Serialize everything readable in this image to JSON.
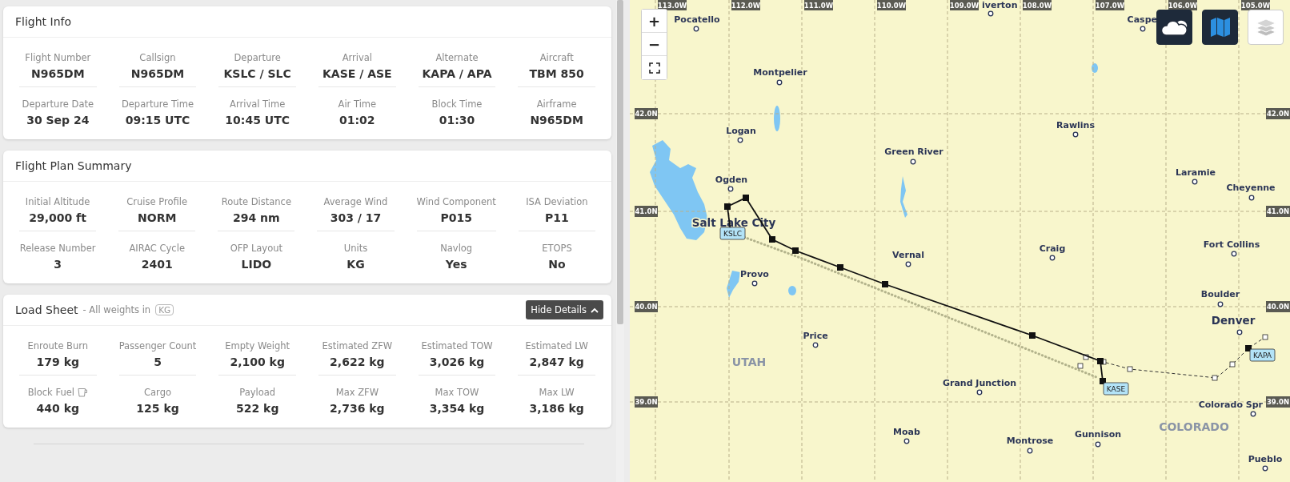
{
  "flight_info": {
    "title": "Flight Info",
    "fields": [
      {
        "label": "Flight Number",
        "value": "N965DM"
      },
      {
        "label": "Callsign",
        "value": "N965DM"
      },
      {
        "label": "Departure",
        "value": "KSLC / SLC"
      },
      {
        "label": "Arrival",
        "value": "KASE / ASE"
      },
      {
        "label": "Alternate",
        "value": "KAPA / APA"
      },
      {
        "label": "Aircraft",
        "value": "TBM 850"
      },
      {
        "label": "Departure Date",
        "value": "30 Sep 24"
      },
      {
        "label": "Departure Time",
        "value": "09:15 UTC"
      },
      {
        "label": "Arrival Time",
        "value": "10:45 UTC"
      },
      {
        "label": "Air Time",
        "value": "01:02"
      },
      {
        "label": "Block Time",
        "value": "01:30"
      },
      {
        "label": "Airframe",
        "value": "N965DM"
      }
    ]
  },
  "flight_plan_summary": {
    "title": "Flight Plan Summary",
    "fields": [
      {
        "label": "Initial Altitude",
        "value": "29,000 ft"
      },
      {
        "label": "Cruise Profile",
        "value": "NORM"
      },
      {
        "label": "Route Distance",
        "value": "294 nm"
      },
      {
        "label": "Average Wind",
        "value": "303 / 17"
      },
      {
        "label": "Wind Component",
        "value": "P015"
      },
      {
        "label": "ISA Deviation",
        "value": "P11"
      },
      {
        "label": "Release Number",
        "value": "3"
      },
      {
        "label": "AIRAC Cycle",
        "value": "2401"
      },
      {
        "label": "OFP Layout",
        "value": "LIDO"
      },
      {
        "label": "Units",
        "value": "KG"
      },
      {
        "label": "Navlog",
        "value": "Yes"
      },
      {
        "label": "ETOPS",
        "value": "No"
      }
    ]
  },
  "load_sheet": {
    "title": "Load Sheet",
    "subtitle": "- All weights in",
    "unit_badge": "KG",
    "toggle_button": "Hide Details",
    "expanded": true,
    "fields": [
      {
        "label": "Enroute Burn",
        "value": "179 kg",
        "kind": "plain"
      },
      {
        "label": "Passenger Count",
        "value": "5",
        "kind": "plain"
      },
      {
        "label": "Empty Weight",
        "value": "2,100 kg",
        "kind": "plain"
      },
      {
        "label": "Estimated ZFW",
        "value": "2,622 kg",
        "kind": "plain"
      },
      {
        "label": "Estimated TOW",
        "value": "3,026 kg",
        "kind": "plain"
      },
      {
        "label": "Estimated LW",
        "value": "2,847 kg",
        "kind": "plain"
      },
      {
        "label": "Block Fuel",
        "value": "440 kg",
        "kind": "fuel"
      },
      {
        "label": "Cargo",
        "value": "125 kg",
        "kind": "plain"
      },
      {
        "label": "Payload",
        "value": "522 kg",
        "kind": "plain"
      },
      {
        "label": "Max ZFW",
        "value": "2,736 kg",
        "kind": "plain"
      },
      {
        "label": "Max TOW",
        "value": "3,354 kg",
        "kind": "plain"
      },
      {
        "label": "Max LW",
        "value": "3,186 kg",
        "kind": "plain"
      }
    ]
  },
  "map": {
    "zoom_in": "+",
    "zoom_out": "−",
    "layer_buttons": [
      {
        "kind": "weather",
        "selected": true
      },
      {
        "kind": "chart",
        "selected": true
      },
      {
        "kind": "layers",
        "selected": false
      }
    ],
    "longitude_labels": [
      "113.0W",
      "112.0W",
      "111.0W",
      "110.0W",
      "109.0W",
      "108.0W",
      "107.0W",
      "106.0W",
      "105.0W"
    ],
    "latitude_labels": [
      {
        "left": "42.0N",
        "right": "42.0N"
      },
      {
        "left": "41.0N",
        "right": "41.0N"
      },
      {
        "left": "40.0N",
        "right": "40.0N"
      },
      {
        "left": "39.0N",
        "right": "39.0N"
      }
    ],
    "cities": [
      {
        "name": "iverton",
        "kind": "town"
      },
      {
        "name": "Caspe",
        "kind": "town"
      },
      {
        "name": "Pocatello",
        "kind": "town"
      },
      {
        "name": "Montpelier",
        "kind": "town"
      },
      {
        "name": "Logan",
        "kind": "town"
      },
      {
        "name": "Green River",
        "kind": "town"
      },
      {
        "name": "Rawlins",
        "kind": "town"
      },
      {
        "name": "Laramie",
        "kind": "town"
      },
      {
        "name": "Cheyenne",
        "kind": "town"
      },
      {
        "name": "Ogden",
        "kind": "town"
      },
      {
        "name": "Salt Lake City",
        "kind": "major"
      },
      {
        "name": "Vernal",
        "kind": "town"
      },
      {
        "name": "Craig",
        "kind": "town"
      },
      {
        "name": "Fort Collins",
        "kind": "town"
      },
      {
        "name": "Provo",
        "kind": "town"
      },
      {
        "name": "Boulder",
        "kind": "town"
      },
      {
        "name": "Denver",
        "kind": "major"
      },
      {
        "name": "Price",
        "kind": "town"
      },
      {
        "name": "Grand Junction",
        "kind": "town"
      },
      {
        "name": "Colorado Spr",
        "kind": "town"
      },
      {
        "name": "Moab",
        "kind": "town"
      },
      {
        "name": "Gunnison",
        "kind": "town"
      },
      {
        "name": "Montrose",
        "kind": "town"
      },
      {
        "name": "Pueblo",
        "kind": "town"
      }
    ],
    "regions": [
      "UTAH",
      "COLORADO"
    ],
    "airports": [
      "KSLC",
      "KASE",
      "KAPA"
    ]
  }
}
